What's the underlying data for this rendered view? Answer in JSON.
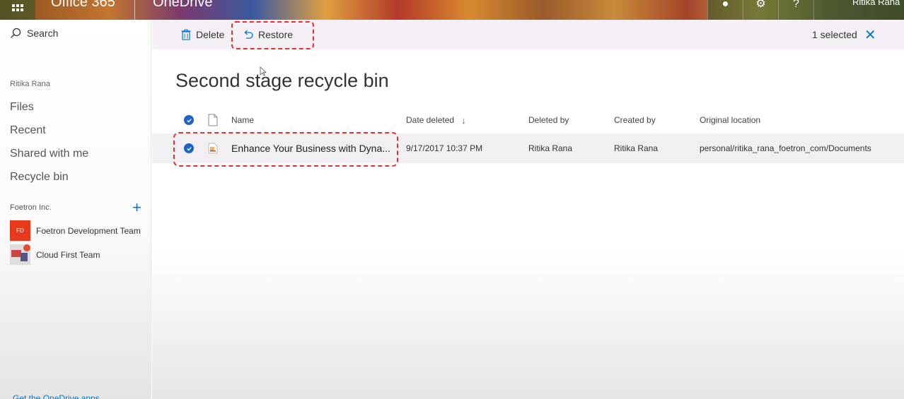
{
  "suite": {
    "app_suite": "Office 365",
    "app_name": "OneDrive",
    "user_name": "Ritika Rana"
  },
  "nav": {
    "search_label": "Search",
    "owner": "Ritika Rana",
    "items": [
      {
        "label": "Files"
      },
      {
        "label": "Recent"
      },
      {
        "label": "Shared with me"
      },
      {
        "label": "Recycle bin"
      }
    ],
    "org_name": "Foetron Inc.",
    "groups": [
      {
        "label": "Foetron Development Team",
        "avatar_text": "FD"
      },
      {
        "label": "Cloud First Team"
      }
    ],
    "get_app": "Get the OneDrive apps"
  },
  "commandbar": {
    "delete_label": "Delete",
    "restore_label": "Restore",
    "selected_text": "1 selected"
  },
  "page": {
    "title": "Second stage recycle bin"
  },
  "table": {
    "columns": {
      "name": "Name",
      "date_deleted": "Date deleted",
      "deleted_by": "Deleted by",
      "created_by": "Created by",
      "original_location": "Original location"
    },
    "rows": [
      {
        "name": "Enhance Your Business with Dyna...",
        "date_deleted": "9/17/2017 10:37 PM",
        "deleted_by": "Ritika Rana",
        "created_by": "Ritika Rana",
        "original_location": "personal/ritika_rana_foetron_com/Documents"
      }
    ]
  },
  "colors": {
    "accent": "#0078d4",
    "check": "#1c64c8",
    "highlight": "#e8302a",
    "commandbar_bg": "#f4f0f6",
    "row_selected_bg": "#f2eff3"
  }
}
